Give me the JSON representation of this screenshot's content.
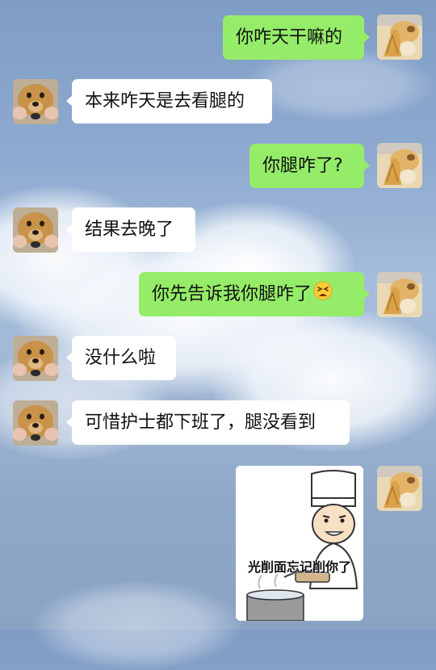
{
  "conversation": {
    "messages": [
      {
        "side": "right",
        "text": "你咋天干嘛的"
      },
      {
        "side": "left",
        "text": "本来咋天是去看腿的"
      },
      {
        "side": "right",
        "text": "你腿咋了?"
      },
      {
        "side": "left",
        "text": "结果去晚了"
      },
      {
        "side": "right",
        "text": "你先告诉我你腿咋了",
        "emoji": "tired-face-emoji"
      },
      {
        "side": "left",
        "text": "没什么啦"
      },
      {
        "side": "left",
        "text": "可惜护士都下班了，腿没看到"
      },
      {
        "side": "right",
        "type": "sticker",
        "caption": "光削面忘记削你了",
        "icon": "chef-sticker"
      }
    ]
  },
  "avatars": {
    "self": "cat-avatar-icon",
    "other": "dog-avatar-icon"
  },
  "colors": {
    "bubble_self": "#95ec69",
    "bubble_other": "#ffffff",
    "sky_background": "#8eaad0"
  }
}
